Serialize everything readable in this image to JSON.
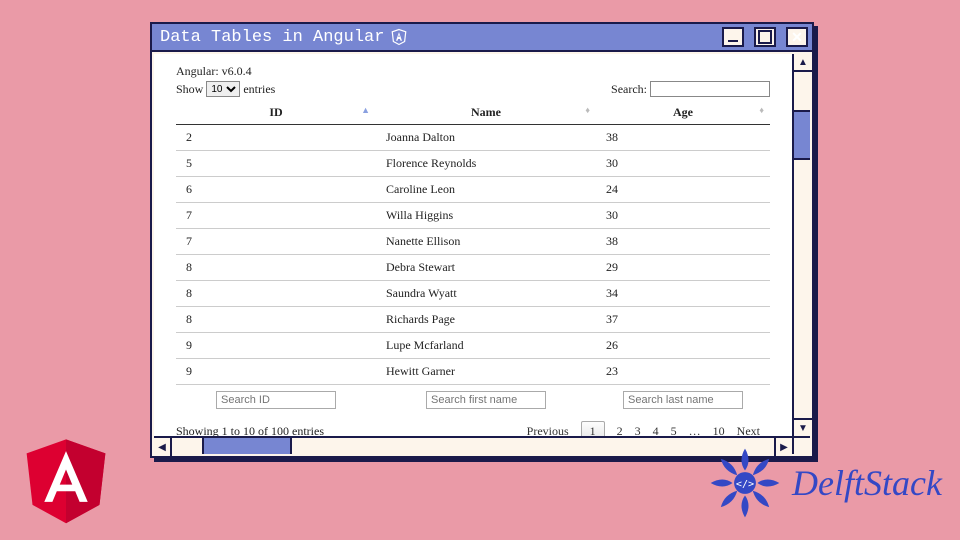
{
  "window": {
    "title": "Data Tables in Angular"
  },
  "header": {
    "framework_line": "Angular: v6.0.4",
    "show_label_pre": "Show",
    "show_label_post": "entries",
    "show_value": "10",
    "search_label": "Search:"
  },
  "columns": {
    "id": "ID",
    "name": "Name",
    "age": "Age"
  },
  "rows": [
    {
      "id": "2",
      "name": "Joanna Dalton",
      "age": "38"
    },
    {
      "id": "5",
      "name": "Florence Reynolds",
      "age": "30"
    },
    {
      "id": "6",
      "name": "Caroline Leon",
      "age": "24"
    },
    {
      "id": "7",
      "name": "Willa Higgins",
      "age": "30"
    },
    {
      "id": "7",
      "name": "Nanette Ellison",
      "age": "38"
    },
    {
      "id": "8",
      "name": "Debra Stewart",
      "age": "29"
    },
    {
      "id": "8",
      "name": "Saundra Wyatt",
      "age": "34"
    },
    {
      "id": "8",
      "name": "Richards Page",
      "age": "37"
    },
    {
      "id": "9",
      "name": "Lupe Mcfarland",
      "age": "26"
    },
    {
      "id": "9",
      "name": "Hewitt Garner",
      "age": "23"
    }
  ],
  "footer_search": {
    "id": "Search ID",
    "first": "Search first name",
    "last": "Search last name"
  },
  "info": "Showing 1 to 10 of 100 entries",
  "pager": {
    "prev": "Previous",
    "pages": [
      "1",
      "2",
      "3",
      "4",
      "5",
      "…",
      "10"
    ],
    "current": "1",
    "next": "Next"
  },
  "brand": {
    "delftstack": "DelftStack"
  }
}
